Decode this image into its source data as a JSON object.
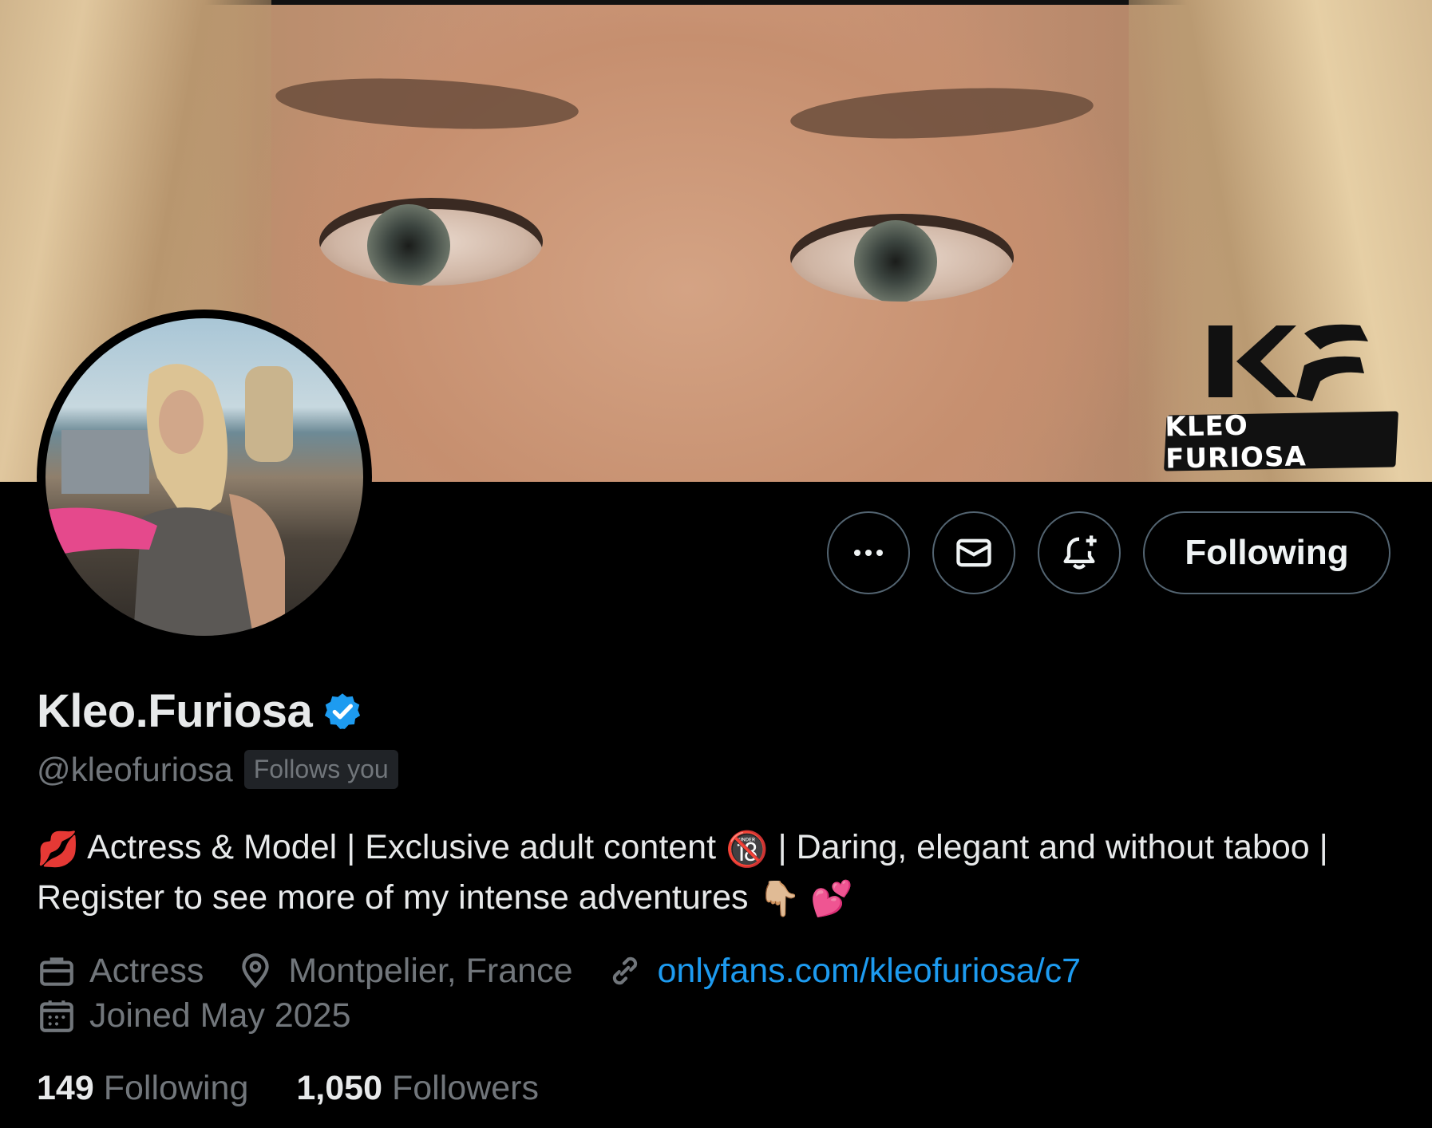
{
  "banner": {
    "logo_mark": "KF",
    "logo_text": "KLEO FURIOSA"
  },
  "actions": {
    "more_icon": "ellipsis-icon",
    "message_icon": "envelope-icon",
    "notify_icon": "bell-plus-icon",
    "following_label": "Following"
  },
  "profile": {
    "display_name": "Kleo.Furiosa",
    "verified_icon": "verified-badge-icon",
    "handle": "@kleofuriosa",
    "follows_you": "Follows you",
    "bio_emoji_lips": "💋",
    "bio_text_1": "Actress & Model | Exclusive adult content",
    "bio_emoji_18": "🔞",
    "bio_text_2": "| Daring, elegant and without taboo | Register to see more of my intense adventures",
    "bio_emoji_point": "👇🏼",
    "bio_emoji_hearts": "💕",
    "profession": "Actress",
    "location": "Montpelier, France",
    "website": "onlyfans.com/kleofuriosa/c7",
    "joined": "Joined May 2025"
  },
  "stats": {
    "following_count": "149",
    "following_label": "Following",
    "followers_count": "1,050",
    "followers_label": "Followers"
  },
  "colors": {
    "accent": "#1d9bf0",
    "muted": "#71767b",
    "border": "#536471",
    "text": "#e7e9ea",
    "background": "#000000"
  }
}
